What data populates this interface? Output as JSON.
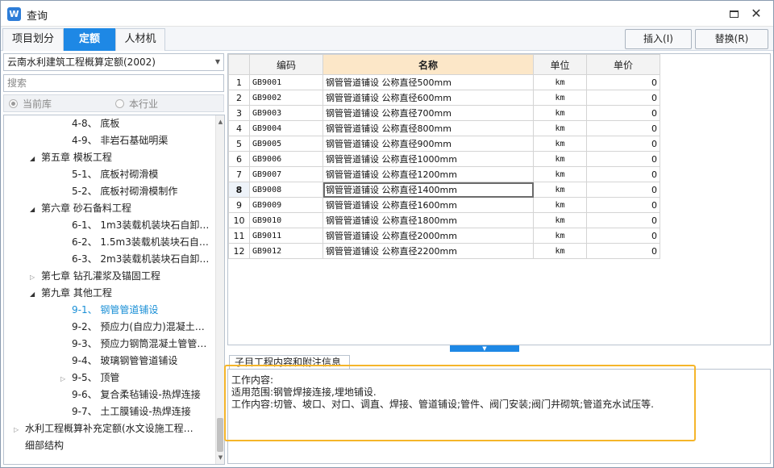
{
  "window": {
    "icon_glyph": "W",
    "title": "查询",
    "maximize_icon": "maximize-icon",
    "close_glyph": "✕"
  },
  "tabs": [
    {
      "label": "项目划分",
      "active": false
    },
    {
      "label": "定额",
      "active": true
    },
    {
      "label": "人材机",
      "active": false
    }
  ],
  "actions": {
    "insert_label": "插入(I)",
    "replace_label": "替换(R)"
  },
  "left": {
    "library": "云南水利建筑工程概算定额(2002)",
    "search_placeholder": "搜索",
    "scope_options": [
      {
        "label": "当前库",
        "checked": true
      },
      {
        "label": "本行业",
        "checked": false
      }
    ],
    "tree": [
      {
        "text": "4-8、  底板",
        "level": 2,
        "arrow": ""
      },
      {
        "text": "4-9、  非岩石基础明渠",
        "level": 2,
        "arrow": ""
      },
      {
        "text": "第五章 模板工程",
        "level": 1,
        "arrow": "open"
      },
      {
        "text": "5-1、  底板衬砌滑模",
        "level": 2,
        "arrow": ""
      },
      {
        "text": "5-2、  底板衬砌滑模制作",
        "level": 2,
        "arrow": ""
      },
      {
        "text": "第六章 砂石备料工程",
        "level": 1,
        "arrow": "open"
      },
      {
        "text": "6-1、  1m3装载机装块石自卸…",
        "level": 2,
        "arrow": ""
      },
      {
        "text": "6-2、  1.5m3装载机装块石自…",
        "level": 2,
        "arrow": ""
      },
      {
        "text": "6-3、  2m3装载机装块石自卸…",
        "level": 2,
        "arrow": ""
      },
      {
        "text": "第七章 钻孔灌浆及锚固工程",
        "level": 1,
        "arrow": "closed"
      },
      {
        "text": "第九章 其他工程",
        "level": 1,
        "arrow": "open"
      },
      {
        "text": "9-1、  钢管管道铺设",
        "level": 2,
        "arrow": "",
        "selected": true
      },
      {
        "text": "9-2、  预应力(自应力)混凝土…",
        "level": 2,
        "arrow": ""
      },
      {
        "text": "9-3、  预应力钢筒混凝土管管…",
        "level": 2,
        "arrow": ""
      },
      {
        "text": "9-4、  玻璃钢管管道铺设",
        "level": 2,
        "arrow": ""
      },
      {
        "text": "9-5、  顶管",
        "level": 2,
        "arrow": "closed"
      },
      {
        "text": "9-6、  复合柔毡铺设-热焊连接",
        "level": 2,
        "arrow": ""
      },
      {
        "text": "9-7、  土工膜铺设-热焊连接",
        "level": 2,
        "arrow": ""
      },
      {
        "text": "水利工程概算补充定额(水文设施工程…",
        "level": 0,
        "arrow": "closed"
      },
      {
        "text": "细部结构",
        "level": 0,
        "arrow": ""
      }
    ]
  },
  "grid": {
    "columns": [
      "编码",
      "名称",
      "单位",
      "单价"
    ],
    "selected_row": 8,
    "rows": [
      {
        "n": "1",
        "code": "GB9001",
        "name": "钢管管道铺设 公称直径500mm",
        "unit": "km",
        "price": "0"
      },
      {
        "n": "2",
        "code": "GB9002",
        "name": "钢管管道铺设 公称直径600mm",
        "unit": "km",
        "price": "0"
      },
      {
        "n": "3",
        "code": "GB9003",
        "name": "钢管管道铺设 公称直径700mm",
        "unit": "km",
        "price": "0"
      },
      {
        "n": "4",
        "code": "GB9004",
        "name": "钢管管道铺设 公称直径800mm",
        "unit": "km",
        "price": "0"
      },
      {
        "n": "5",
        "code": "GB9005",
        "name": "钢管管道铺设 公称直径900mm",
        "unit": "km",
        "price": "0"
      },
      {
        "n": "6",
        "code": "GB9006",
        "name": "钢管管道铺设 公称直径1000mm",
        "unit": "km",
        "price": "0"
      },
      {
        "n": "7",
        "code": "GB9007",
        "name": "钢管管道铺设 公称直径1200mm",
        "unit": "km",
        "price": "0"
      },
      {
        "n": "8",
        "code": "GB9008",
        "name": "钢管管道铺设 公称直径1400mm",
        "unit": "km",
        "price": "0"
      },
      {
        "n": "9",
        "code": "GB9009",
        "name": "钢管管道铺设 公称直径1600mm",
        "unit": "km",
        "price": "0"
      },
      {
        "n": "10",
        "code": "GB9010",
        "name": "钢管管道铺设 公称直径1800mm",
        "unit": "km",
        "price": "0"
      },
      {
        "n": "11",
        "code": "GB9011",
        "name": "钢管管道铺设 公称直径2000mm",
        "unit": "km",
        "price": "0"
      },
      {
        "n": "12",
        "code": "GB9012",
        "name": "钢管管道铺设 公称直径2200mm",
        "unit": "km",
        "price": "0"
      }
    ]
  },
  "info": {
    "tab_label": "子目工程内容和附注信息",
    "lines": [
      "工作内容:",
      "适用范围:钢管焊接连接,埋地铺设.",
      "工作内容:切管、坡口、对口、调直、焊接、管道铺设;管件、阀门安装;阀门井砌筑;管道充水试压等."
    ]
  },
  "colors": {
    "accent": "#1e88e5",
    "selected_tree": "#1a8fd6",
    "name_header": "#fce7c8",
    "highlight_border": "#f5b52a"
  }
}
